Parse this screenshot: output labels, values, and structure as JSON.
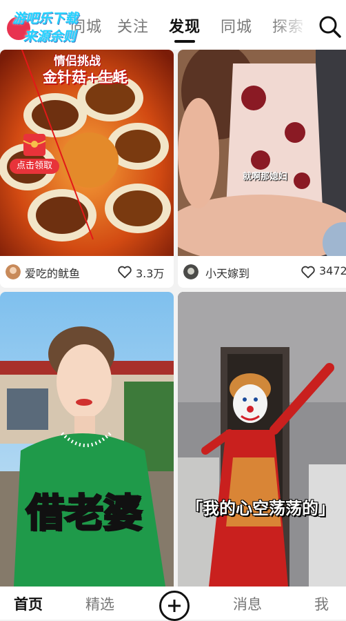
{
  "overlay": {
    "brand_line1": "游吧乐下载",
    "brand_line2": "来源余则"
  },
  "top_nav": {
    "tabs": [
      {
        "label": "同城",
        "active": false
      },
      {
        "label": "关注",
        "active": false
      },
      {
        "label": "发现",
        "active": true
      },
      {
        "label": "同城",
        "active": false
      },
      {
        "label": "探索",
        "active": false
      }
    ],
    "search_icon": "search-icon"
  },
  "feed": [
    {
      "title_top": "情侣挑战",
      "title_main": "金针菇+生蚝",
      "cta_label": "点击领取",
      "author": "爱吃的鱿鱼",
      "likes": "3.3万"
    },
    {
      "caption": "就啊那媳妇",
      "author": "小天嫁到",
      "likes": "3472"
    },
    {
      "caption": "借老婆"
    },
    {
      "caption": "「我的心空荡荡的」"
    }
  ],
  "bottom_nav": {
    "items": [
      {
        "label": "首页",
        "active": true
      },
      {
        "label": "精选",
        "active": false
      },
      {
        "label": "消息",
        "active": false
      },
      {
        "label": "我",
        "active": false
      }
    ],
    "plus_icon": "plus-icon"
  },
  "colors": {
    "brand_red": "#e83350",
    "overlay_cyan": "#22d3ff",
    "caption_yellow": "#ffe31a"
  }
}
